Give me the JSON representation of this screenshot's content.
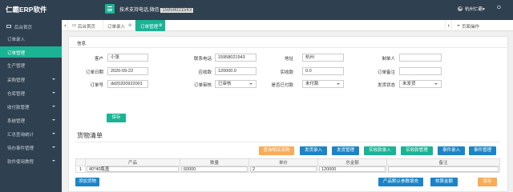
{
  "app": {
    "brand": "仁霸ERP软件",
    "support_label": "技术支持电话,微信:",
    "support_phone": "15958021543",
    "user_name": "杭州仁霸",
    "user_caret": "▾",
    "exit_icon": "exit-icon"
  },
  "sidebar": {
    "items": [
      {
        "label": "后台首页",
        "has_arrow": false
      },
      {
        "label": "订单录入",
        "has_arrow": false
      },
      {
        "label": "订单管理",
        "has_arrow": false,
        "active": true
      },
      {
        "label": "生产管理",
        "has_arrow": false
      },
      {
        "label": "采购管理",
        "has_arrow": true
      },
      {
        "label": "仓库管理",
        "has_arrow": true
      },
      {
        "label": "收付款管理",
        "has_arrow": true
      },
      {
        "label": "系统管理",
        "has_arrow": true
      },
      {
        "label": "汇总查询统计",
        "has_arrow": true
      },
      {
        "label": "待办事件管理",
        "has_arrow": true
      },
      {
        "label": "软件使用教程",
        "has_arrow": true
      }
    ]
  },
  "tabs": {
    "items": [
      {
        "label": "后台首页",
        "close": ""
      },
      {
        "label": "订单录入",
        "close": "⊗"
      },
      {
        "label": "订单管理",
        "close": "⊗"
      }
    ],
    "ops_label": "页面操作"
  },
  "panel": {
    "title": "信息"
  },
  "form": {
    "customer_label": "客户",
    "customer_value": "小张",
    "phone_label": "联系电话",
    "phone_value": "15958021543",
    "address_label": "地址",
    "address_value": "杭州",
    "creator_label": "制单人",
    "creator_value": "",
    "date_label": "订单日期",
    "date_value": "2020-09-22",
    "receivable_label": "应收款",
    "receivable_value": "120000.0",
    "received_label": "实收款",
    "received_value": "0.0",
    "remark_label": "订单备注",
    "remark_value": "",
    "order_no_label": "订单号",
    "order_no_value": "dd20200922001",
    "audit_label": "订单审核",
    "audit_value": "已审核",
    "done_label": "是否已付款",
    "done_value": "未付款",
    "ship_label": "发货状态",
    "ship_value": "未发货",
    "save_label": "保存"
  },
  "goods": {
    "title": "货物清单",
    "buttons": [
      {
        "label": "查询相关采购",
        "color": "#f8ac59"
      },
      {
        "label": "发货录入",
        "color": "#1c84c6"
      },
      {
        "label": "发货管理",
        "color": "#1c84c6"
      },
      {
        "label": "实收款录入",
        "color": "#1ab394"
      },
      {
        "label": "实收款管理",
        "color": "#1ab394"
      },
      {
        "label": "事件录入",
        "color": "#1c84c6"
      },
      {
        "label": "事件管理",
        "color": "#1c84c6"
      }
    ],
    "columns": [
      "",
      "产品",
      "数量",
      "单价",
      "总金额",
      "备注"
    ],
    "rows": [
      {
        "index": "1",
        "product": "40*40瓶盖",
        "qty": "60000",
        "price": "2",
        "total": "120000",
        "note": ""
      }
    ],
    "add_label": "添加货物",
    "recalc_label": "产品默认参数填充",
    "sum_label": "核算金额",
    "save_label": "保存"
  }
}
